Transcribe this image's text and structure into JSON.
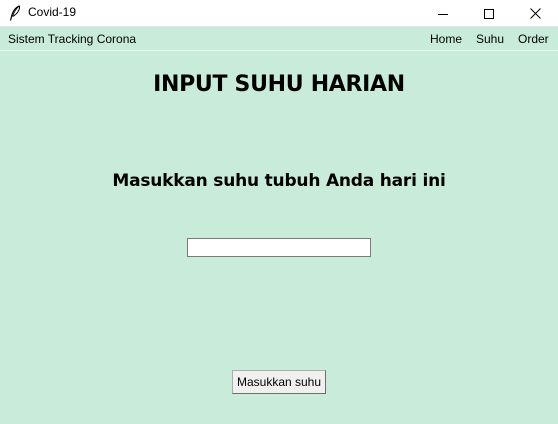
{
  "window": {
    "title": "Covid-19",
    "icon": "feather-icon",
    "controls": [
      "minimize-icon",
      "maximize-icon",
      "close-icon"
    ]
  },
  "menubar": {
    "brand": "Sistem Tracking Corona",
    "items": [
      {
        "label": "Home"
      },
      {
        "label": "Suhu"
      },
      {
        "label": "Order"
      }
    ]
  },
  "main": {
    "heading": "INPUT SUHU HARIAN",
    "prompt": "Masukkan suhu tubuh Anda hari ini",
    "temperature_input": {
      "value": "",
      "placeholder": ""
    },
    "submit_label": "Masukkan suhu"
  },
  "colors": {
    "background": "#c8ecd9",
    "titlebar": "#ffffff",
    "button": "#f0f0f0"
  }
}
